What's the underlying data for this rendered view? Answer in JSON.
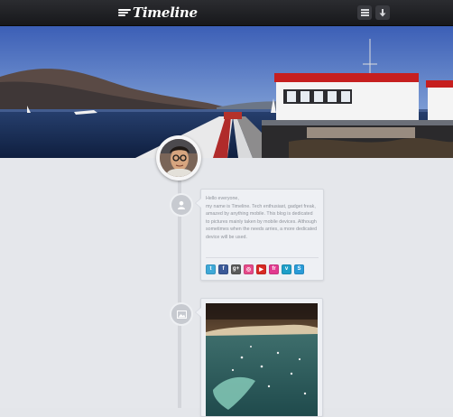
{
  "app": {
    "logo_text": "Timeline"
  },
  "toolbar": {
    "menu_icon": "hamburger-menu-icon",
    "download_icon": "download-arrow-icon"
  },
  "cover": {
    "scene": "pier-and-bay-photo"
  },
  "profile": {
    "avatar_icon": "profile-photo"
  },
  "posts": [
    {
      "type": "text",
      "node_icon": "user-icon",
      "lines": [
        "Hello everyone,",
        "my name is Timeline. Tech enthusiast, gadget freak, amazed by anything mobile. This blog is dedicated to pictures mainly taken by mobile devices. Although sometimes when the needs arries, a more dedicated device will be used."
      ],
      "social": [
        {
          "name": "twitter",
          "glyph": "t",
          "color": "#3fa9d8"
        },
        {
          "name": "facebook",
          "glyph": "f",
          "color": "#3b5998"
        },
        {
          "name": "google-plus",
          "glyph": "g+",
          "color": "#5a5a5a"
        },
        {
          "name": "dribbble",
          "glyph": "◎",
          "color": "#e64b8a"
        },
        {
          "name": "youtube",
          "glyph": "▶",
          "color": "#d82a24"
        },
        {
          "name": "flickr",
          "glyph": "fr",
          "color": "#e2398f"
        },
        {
          "name": "vimeo",
          "glyph": "v",
          "color": "#1f9fc8"
        },
        {
          "name": "skype",
          "glyph": "S",
          "color": "#2a9bd8"
        }
      ]
    },
    {
      "type": "photo",
      "node_icon": "image-icon",
      "photo": "aerial-coast-photo"
    }
  ]
}
